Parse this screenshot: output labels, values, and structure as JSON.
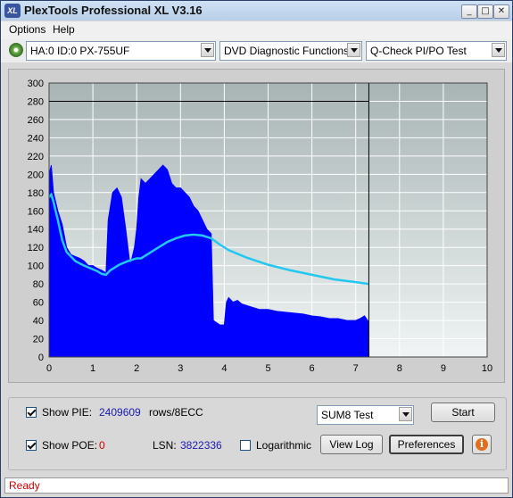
{
  "window": {
    "title": "PlexTools Professional XL V3.16",
    "icon_text": "XL",
    "controls": [
      "minimize-icon",
      "maximize-icon",
      "close-icon"
    ]
  },
  "menu": {
    "items": [
      "Options",
      "Help"
    ]
  },
  "toolbar": {
    "drive": "HA:0 ID:0  PX-755UF",
    "function": "DVD Diagnostic Functions",
    "test": "Q-Check PI/PO Test"
  },
  "chart_data": {
    "type": "area",
    "xlim": [
      0,
      10
    ],
    "ylim": [
      0,
      300
    ],
    "x_ticks": [
      "0",
      "1",
      "2",
      "3",
      "4",
      "5",
      "6",
      "7",
      "8",
      "9",
      "10"
    ],
    "y_ticks": [
      "0",
      "20",
      "40",
      "60",
      "80",
      "100",
      "120",
      "140",
      "160",
      "180",
      "200",
      "220",
      "240",
      "260",
      "280",
      "300"
    ],
    "grid": true,
    "end_marker_x": 7.3,
    "colors": {
      "pie_fill": "#0000ff",
      "speed_line": "#22c8f0",
      "grid": "#ffffff",
      "plot_bg_top": "#a8b4b4",
      "plot_bg_bottom": "#f0f4f4"
    },
    "series": [
      {
        "x": [
          0,
          0.05,
          0.1,
          0.2,
          0.3,
          0.4,
          0.5,
          0.6,
          0.7,
          0.8,
          0.9,
          1.0,
          1.1,
          1.2,
          1.3,
          1.35,
          1.45,
          1.55,
          1.65,
          1.75,
          1.85,
          1.95,
          2.0,
          2.05,
          2.1,
          2.2,
          2.3,
          2.4,
          2.5,
          2.6,
          2.7,
          2.8,
          2.9,
          3.0,
          3.1,
          3.2,
          3.3,
          3.4,
          3.5,
          3.6,
          3.7,
          3.75,
          3.9,
          4.0,
          4.05,
          4.1,
          4.2,
          4.3,
          4.4,
          4.6,
          4.8,
          5.0,
          5.2,
          5.4,
          5.6,
          5.8,
          6.0,
          6.2,
          6.4,
          6.6,
          6.8,
          7.0,
          7.1,
          7.2,
          7.3
        ],
        "values": [
          200,
          210,
          180,
          160,
          145,
          120,
          112,
          110,
          108,
          105,
          100,
          100,
          97,
          95,
          92,
          150,
          180,
          185,
          175,
          140,
          100,
          120,
          140,
          175,
          195,
          190,
          195,
          200,
          205,
          210,
          205,
          190,
          185,
          185,
          180,
          175,
          165,
          160,
          150,
          140,
          135,
          40,
          35,
          35,
          60,
          65,
          60,
          62,
          58,
          55,
          52,
          52,
          50,
          49,
          48,
          47,
          45,
          44,
          42,
          42,
          40,
          40,
          42,
          45,
          38
        ]
      },
      {
        "x": [
          0,
          0.05,
          0.1,
          0.2,
          0.3,
          0.4,
          0.6,
          0.8,
          1.0,
          1.1,
          1.2,
          1.3,
          1.4,
          1.6,
          1.8,
          2.0,
          2.1,
          2.3,
          2.5,
          2.7,
          2.9,
          3.1,
          3.3,
          3.5,
          3.7,
          3.9,
          4.1,
          4.5,
          5.0,
          5.5,
          6.0,
          6.5,
          7.0,
          7.3
        ],
        "values": [
          175,
          178,
          170,
          150,
          128,
          115,
          105,
          100,
          96,
          94,
          91,
          90,
          95,
          101,
          105,
          108,
          108,
          114,
          120,
          126,
          130,
          133,
          134,
          133,
          130,
          123,
          117,
          109,
          101,
          95,
          90,
          85,
          82,
          80
        ]
      }
    ]
  },
  "options": {
    "show_pie_label": "Show PIE:",
    "show_pie_checked": true,
    "pie_value": "2409609",
    "pie_unit": "rows/8ECC",
    "show_poe_label": "Show POE:",
    "show_poe_checked": true,
    "poe_value": "0",
    "lsn_label": "LSN:",
    "lsn_value": "3822336",
    "logarithmic_label": "Logarithmic",
    "logarithmic_checked": false,
    "sum_test": "SUM8 Test"
  },
  "buttons": {
    "start": "Start",
    "view_log": "View Log",
    "preferences": "Preferences",
    "info": "i"
  },
  "status": "Ready"
}
